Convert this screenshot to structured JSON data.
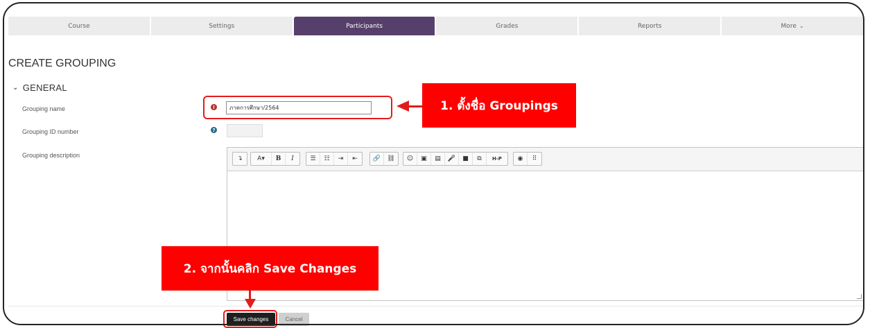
{
  "tabs": [
    {
      "label": "Course"
    },
    {
      "label": "Settings"
    },
    {
      "label": "Participants",
      "active": true
    },
    {
      "label": "Grades"
    },
    {
      "label": "Reports"
    },
    {
      "label": "More"
    }
  ],
  "page": {
    "title": "CREATE GROUPING"
  },
  "section": {
    "title": "GENERAL"
  },
  "form": {
    "grouping_name_label": "Grouping name",
    "grouping_name_value": "ภาคการศึกษา/2564",
    "grouping_id_label": "Grouping ID number",
    "grouping_id_value": "",
    "grouping_description_label": "Grouping description"
  },
  "toolbar": {
    "group1": [
      "↴"
    ],
    "group2": [
      "A▾",
      "B",
      "I"
    ],
    "group3": [
      "☰",
      "☷",
      "⇥",
      "⇤"
    ],
    "group4": [
      "🔗",
      "⛓"
    ],
    "group5": [
      "☺",
      "▣",
      "▤",
      "🎤",
      "■",
      "⧉",
      "H-P"
    ],
    "group6": [
      "◉",
      "⠿"
    ]
  },
  "buttons": {
    "save": "Save changes",
    "cancel": "Cancel"
  },
  "annotations": {
    "step1": "1. ตั้งชื่อ Groupings",
    "step2": "2. จากนั้นคลิก Save Changes"
  },
  "colors": {
    "active_tab": "#573f6b",
    "annotation": "#ff0000",
    "save_button": "#1f1f1f"
  }
}
